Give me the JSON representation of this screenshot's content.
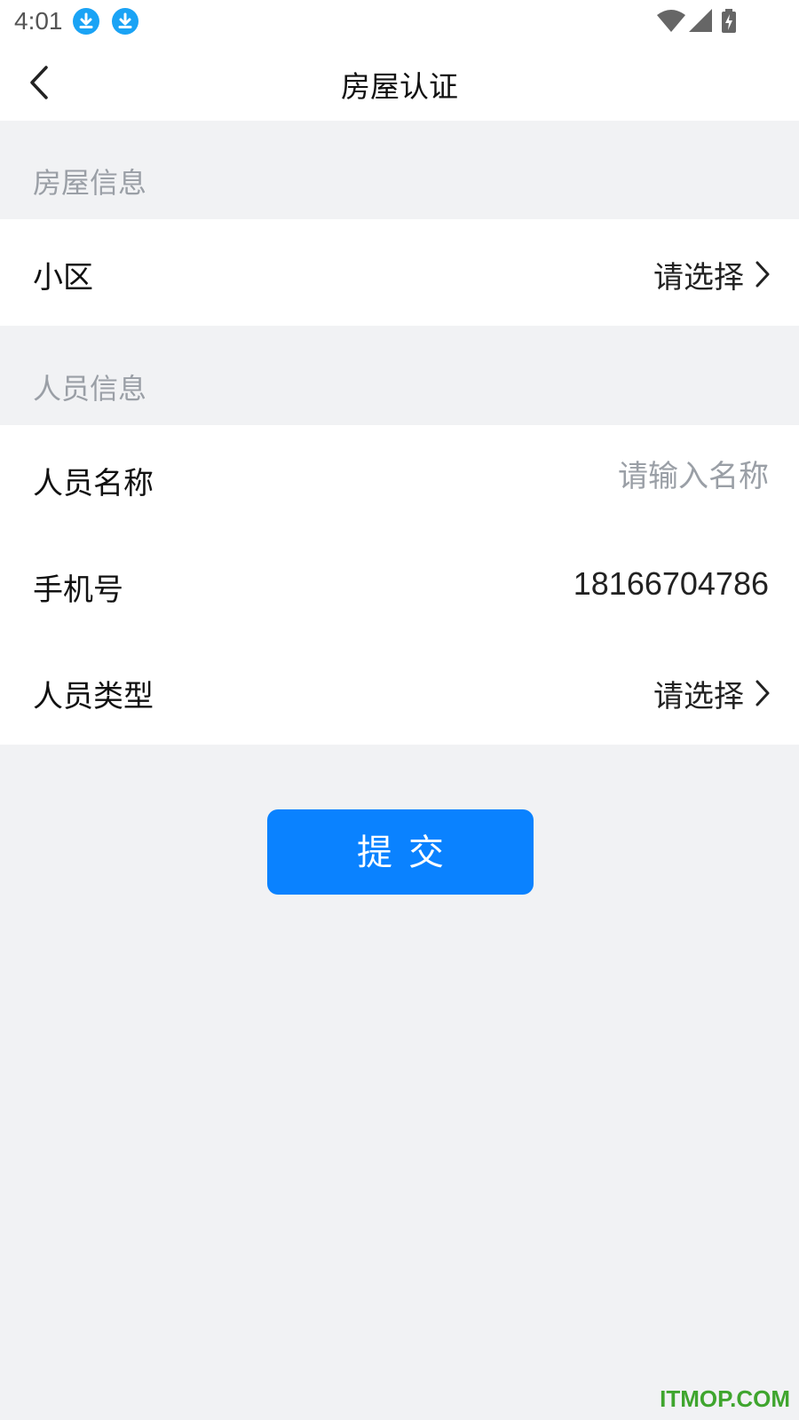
{
  "status_bar": {
    "time": "4:01",
    "icons": [
      "download-icon",
      "download-icon",
      "wifi-icon",
      "signal-icon",
      "battery-icon"
    ]
  },
  "nav": {
    "back_icon": "chevron-left-icon",
    "title": "房屋认证"
  },
  "house_section": {
    "title": "房屋信息",
    "community": {
      "label": "小区",
      "value": "请选择"
    }
  },
  "person_section": {
    "title": "人员信息",
    "name": {
      "label": "人员名称",
      "placeholder": "请输入名称",
      "value": ""
    },
    "phone": {
      "label": "手机号",
      "value": "18166704786"
    },
    "type": {
      "label": "人员类型",
      "value": "请选择"
    }
  },
  "submit": {
    "label": "提交"
  },
  "watermark": "ITMOP.COM",
  "colors": {
    "accent": "#0a82ff",
    "background": "#f1f2f4",
    "section_text": "#9a9fa6",
    "download_badge": "#1aa3f5",
    "watermark": "#3fa52e"
  }
}
